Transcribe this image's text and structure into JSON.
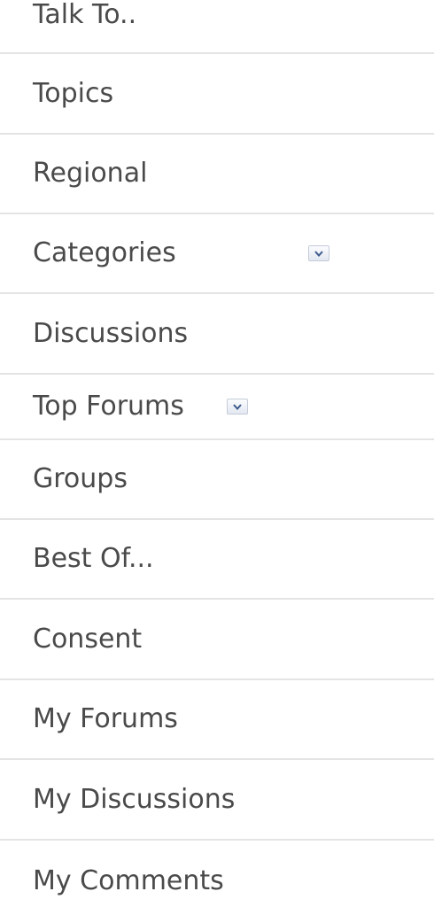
{
  "menu": {
    "items": [
      {
        "label": "Talk To.."
      },
      {
        "label": "Topics"
      },
      {
        "label": "Regional"
      },
      {
        "label": "Categories",
        "icon": "chevron-down-icon"
      },
      {
        "label": "Discussions"
      },
      {
        "label": "Top Forums",
        "icon": "chevron-down-icon"
      },
      {
        "label": "Groups"
      },
      {
        "label": "Best Of..."
      },
      {
        "label": "Consent"
      },
      {
        "label": "My Forums"
      },
      {
        "label": "My Discussions"
      },
      {
        "label": "My Comments"
      }
    ]
  },
  "colors": {
    "text": "#4a4a4a",
    "divider": "#e4e4e4",
    "background": "#ffffff",
    "dropdown_arrow": "#3d5a8c"
  }
}
